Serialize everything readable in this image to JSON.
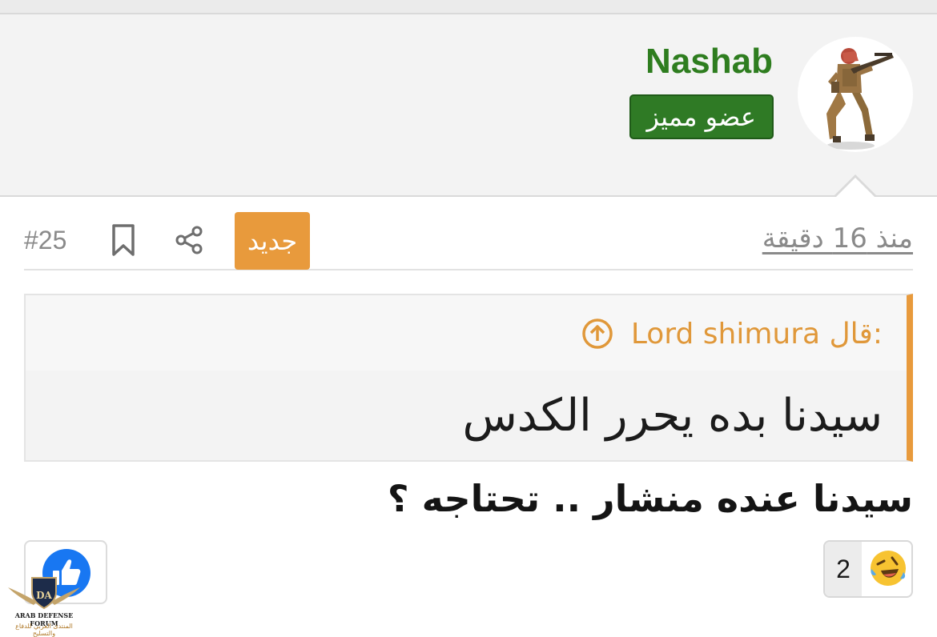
{
  "user": {
    "name": "Nashab",
    "title_badge": "عضو مميز",
    "avatar_icon": "soldier-avatar-icon"
  },
  "post": {
    "time": "منذ 16 دقيقة",
    "new_badge": "جديد",
    "number": "#25",
    "body": "سيدنا عنده منشار .. تحتاجه ؟"
  },
  "quote": {
    "author_line": "Lord shimura قال:",
    "text": "سيدنا بده يحرر الكدس"
  },
  "reactions": {
    "count": "2",
    "emoji_icon": "laughing-tears-icon",
    "like_icon": "thumbs-up-icon"
  },
  "watermark": {
    "logo_text": "DA",
    "title": "ARAB DEFENSE FORUM",
    "subtitle": "المنتدى العربي للدفاع والتسليح"
  },
  "colors": {
    "accent_orange": "#e89a3c",
    "badge_green": "#2f7a25",
    "username_green": "#2e7d1f",
    "like_blue": "#1877f2"
  }
}
